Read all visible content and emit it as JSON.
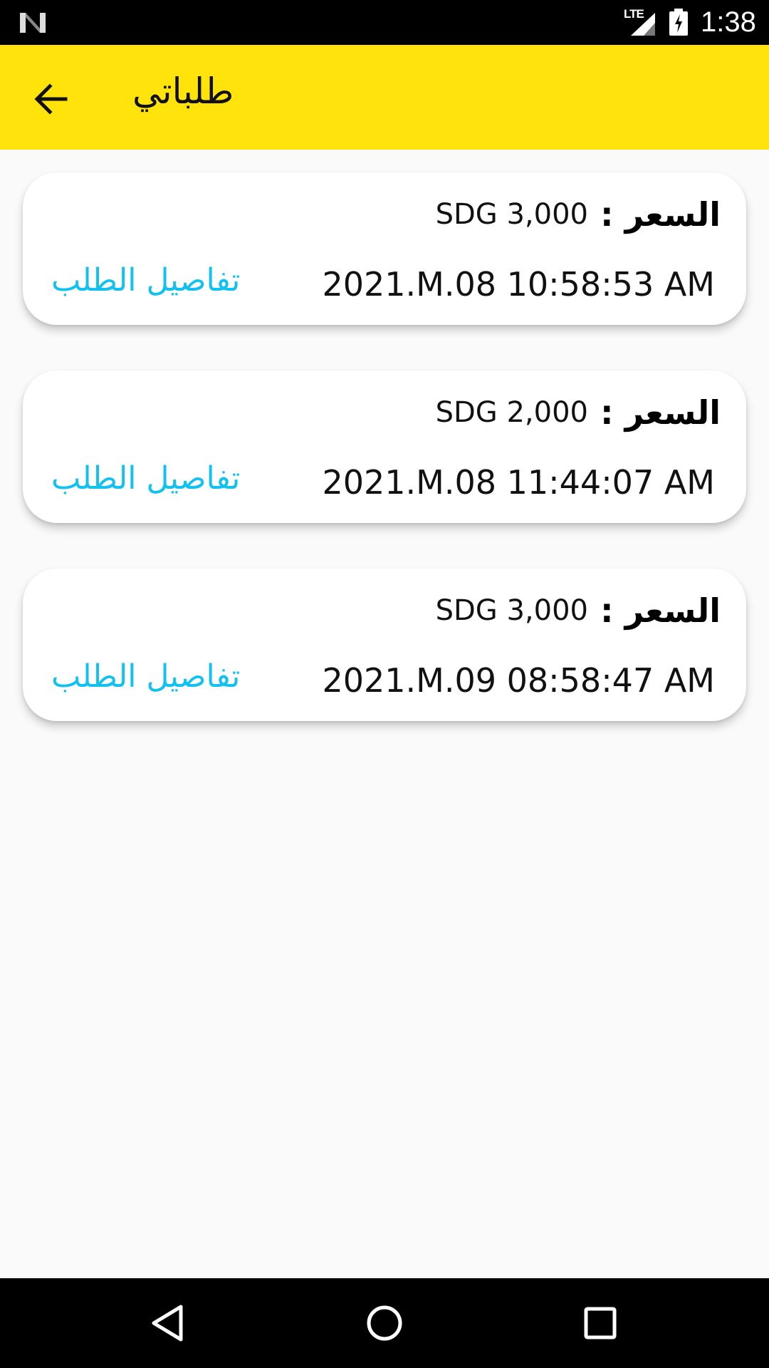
{
  "status_bar": {
    "network_type": "LTE",
    "time": "1:38",
    "icons": [
      "n-logo-icon",
      "signal-icon",
      "battery-charging-icon"
    ]
  },
  "app_bar": {
    "title": "طلباتي",
    "back_icon": "arrow-back-icon",
    "background_color": "#ffe30a"
  },
  "orders": [
    {
      "price_label": "السعر :",
      "price": "SDG 3,000",
      "date": "2021.M.08 10:58:53 AM",
      "details_label": "تفاصيل الطلب"
    },
    {
      "price_label": "السعر :",
      "price": "SDG 2,000",
      "date": "2021.M.08 11:44:07 AM",
      "details_label": "تفاصيل الطلب"
    },
    {
      "price_label": "السعر :",
      "price": "SDG 3,000",
      "date": "2021.M.09 08:58:47 AM",
      "details_label": "تفاصيل الطلب"
    }
  ],
  "colors": {
    "link": "#13c1f0",
    "accent": "#ffe30a"
  },
  "nav_bar": {
    "icons": [
      "back-triangle-icon",
      "home-circle-icon",
      "recents-square-icon"
    ]
  }
}
